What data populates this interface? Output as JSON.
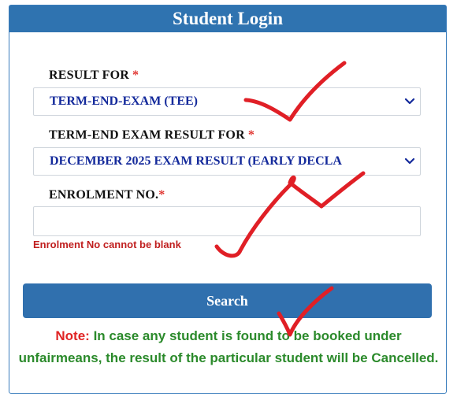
{
  "header": {
    "title": "Student Login"
  },
  "form": {
    "result_for": {
      "label": "RESULT FOR",
      "required_mark": "*",
      "selected": "TERM-END-EXAM (TEE)"
    },
    "tee_result_for": {
      "label": "TERM-END EXAM RESULT FOR",
      "required_mark": "*",
      "selected": "DECEMBER 2025 EXAM RESULT (EARLY DECLA"
    },
    "enrolment": {
      "label": "ENROLMENT NO.",
      "required_mark": "*",
      "value": "",
      "error": "Enrolment No cannot be blank"
    },
    "search_label": "Search"
  },
  "note": {
    "label": "Note:",
    "text": "In case any student is found to be booked under unfairmeans, the result of the particular student will be Cancelled."
  },
  "colors": {
    "header_bg": "#2f73b0",
    "select_text": "#142a9b",
    "required": "#e0342f",
    "error": "#c01f1f",
    "note_text": "#2b8a2b",
    "note_label": "#e02424",
    "annotation_marks": "#e01f26"
  },
  "icons": {
    "dropdown": "chevron-down-icon",
    "annotation": "checkmark-icon"
  }
}
